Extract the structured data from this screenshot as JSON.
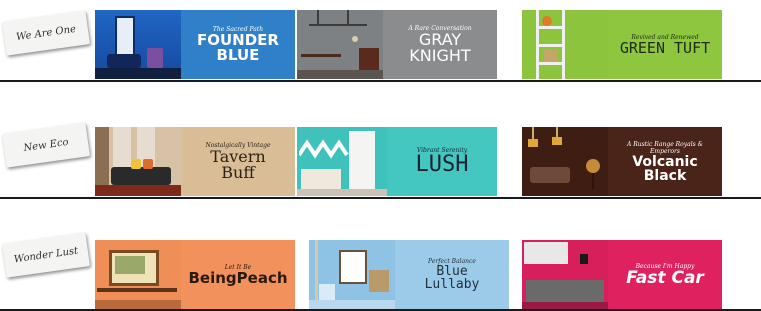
{
  "rows": [
    {
      "tag": "We Are One",
      "panels": [
        {
          "subtitle": "The Sacred Path",
          "name": "FOUNDER BLUE",
          "bg": "#2f80c8",
          "color": "#ffffff"
        },
        {
          "subtitle": "A Rare Conversation",
          "name": "GRAY KNIGHT",
          "bg": "#8b8c8e",
          "color": "#ffffff"
        },
        {
          "subtitle": "Revived and Renewed",
          "name": "GREEN TUFT",
          "bg": "#8fc63f",
          "color": "#1f2a12"
        }
      ]
    },
    {
      "tag": "New Eco",
      "panels": [
        {
          "subtitle": "Nostalgically Vintage",
          "name": "Tavern Buff",
          "bg": "#d9bd97",
          "color": "#2b2216"
        },
        {
          "subtitle": "Vibrant Serenity",
          "name": "LUSH",
          "bg": "#43c7c0",
          "color": "#1b2230"
        },
        {
          "subtitle": "A Rustic Range Royals & Emperors",
          "name": "Volcanic Black",
          "bg": "#4a2418",
          "color": "#ffffff"
        }
      ]
    },
    {
      "tag": "Wonder Lust",
      "panels": [
        {
          "subtitle": "Let It Be",
          "name": "BeingPeach",
          "bg": "#f2915c",
          "color": "#2a1a10"
        },
        {
          "subtitle": "Perfect Balance",
          "name": "Blue Lullaby",
          "bg": "#9ccbea",
          "color": "#22303c"
        },
        {
          "subtitle": "Because I'm Happy",
          "name": "Fast Car",
          "bg": "#df2160",
          "color": "#ffffff"
        }
      ]
    }
  ]
}
